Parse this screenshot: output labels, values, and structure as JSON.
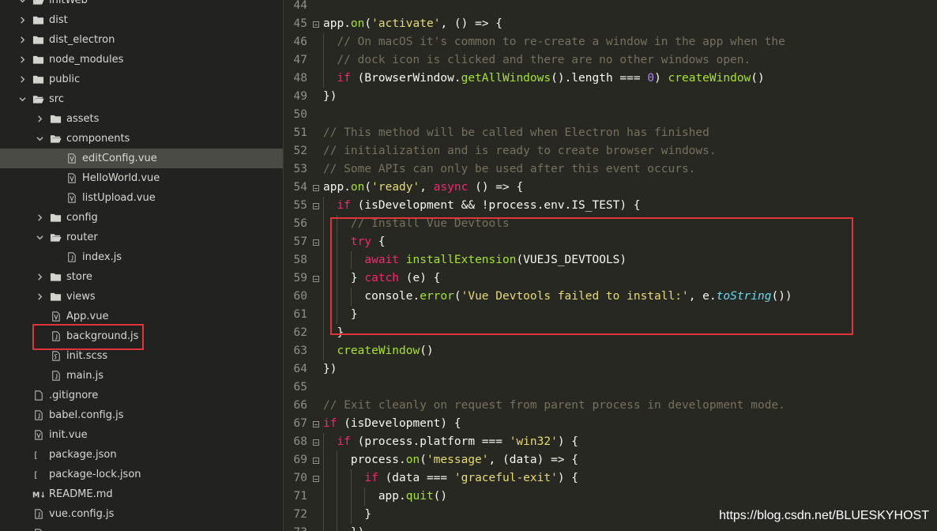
{
  "sidebar": {
    "items": [
      {
        "label": "initWeb",
        "type": "folder",
        "depth": 0,
        "open": true
      },
      {
        "label": "dist",
        "type": "folder",
        "depth": 1,
        "open": false
      },
      {
        "label": "dist_electron",
        "type": "folder",
        "depth": 1,
        "open": false
      },
      {
        "label": "node_modules",
        "type": "folder",
        "depth": 1,
        "open": false
      },
      {
        "label": "public",
        "type": "folder",
        "depth": 1,
        "open": false
      },
      {
        "label": "src",
        "type": "folder",
        "depth": 1,
        "open": true
      },
      {
        "label": "assets",
        "type": "folder",
        "depth": 2,
        "open": false
      },
      {
        "label": "components",
        "type": "folder",
        "depth": 2,
        "open": true
      },
      {
        "label": "editConfig.vue",
        "type": "vue",
        "depth": 3,
        "selected": true
      },
      {
        "label": "HelloWorld.vue",
        "type": "vue",
        "depth": 3
      },
      {
        "label": "listUpload.vue",
        "type": "vue",
        "depth": 3
      },
      {
        "label": "config",
        "type": "folder",
        "depth": 2,
        "open": false
      },
      {
        "label": "router",
        "type": "folder",
        "depth": 2,
        "open": true
      },
      {
        "label": "index.js",
        "type": "js",
        "depth": 3
      },
      {
        "label": "store",
        "type": "folder",
        "depth": 2,
        "open": false
      },
      {
        "label": "views",
        "type": "folder",
        "depth": 2,
        "open": false
      },
      {
        "label": "App.vue",
        "type": "vue",
        "depth": 2
      },
      {
        "label": "background.js",
        "type": "js",
        "depth": 2,
        "highlighted": true
      },
      {
        "label": "init.scss",
        "type": "scss",
        "depth": 2
      },
      {
        "label": "main.js",
        "type": "js",
        "depth": 2
      },
      {
        "label": ".gitignore",
        "type": "file",
        "depth": 1
      },
      {
        "label": "babel.config.js",
        "type": "js",
        "depth": 1
      },
      {
        "label": "init.vue",
        "type": "vue",
        "depth": 1
      },
      {
        "label": "package.json",
        "type": "json",
        "depth": 1
      },
      {
        "label": "package-lock.json",
        "type": "json",
        "depth": 1
      },
      {
        "label": "README.md",
        "type": "md",
        "depth": 1
      },
      {
        "label": "vue.config.js",
        "type": "js",
        "depth": 1
      },
      {
        "label": "",
        "type": "file",
        "depth": 1
      }
    ]
  },
  "editor": {
    "lines": [
      {
        "n": "44",
        "fold": false,
        "indent": 0,
        "tokens": []
      },
      {
        "n": "45",
        "fold": true,
        "indent": 0,
        "tokens": [
          [
            "p",
            "app."
          ],
          [
            "fn",
            "on"
          ],
          [
            "p",
            "("
          ],
          [
            "str",
            "'activate'"
          ],
          [
            "p",
            ", () => {"
          ]
        ]
      },
      {
        "n": "46",
        "fold": false,
        "indent": 1,
        "tokens": [
          [
            "cm",
            "// On macOS it's common to re-create a window in the app when the"
          ]
        ]
      },
      {
        "n": "47",
        "fold": false,
        "indent": 1,
        "tokens": [
          [
            "cm",
            "// dock icon is clicked and there are no other windows open."
          ]
        ]
      },
      {
        "n": "48",
        "fold": false,
        "indent": 1,
        "tokens": [
          [
            "kw",
            "if"
          ],
          [
            "p",
            " (BrowserWindow."
          ],
          [
            "fn",
            "getAllWindows"
          ],
          [
            "p",
            "().length === "
          ],
          [
            "num",
            "0"
          ],
          [
            "p",
            ") "
          ],
          [
            "fn",
            "createWindow"
          ],
          [
            "p",
            "()"
          ]
        ]
      },
      {
        "n": "49",
        "fold": false,
        "indent": 0,
        "tokens": [
          [
            "p",
            "})"
          ]
        ]
      },
      {
        "n": "50",
        "fold": false,
        "indent": 0,
        "tokens": []
      },
      {
        "n": "51",
        "fold": false,
        "indent": 0,
        "tokens": [
          [
            "cm",
            "// This method will be called when Electron has finished"
          ]
        ]
      },
      {
        "n": "52",
        "fold": false,
        "indent": 0,
        "tokens": [
          [
            "cm",
            "// initialization and is ready to create browser windows."
          ]
        ]
      },
      {
        "n": "53",
        "fold": false,
        "indent": 0,
        "tokens": [
          [
            "cm",
            "// Some APIs can only be used after this event occurs."
          ]
        ]
      },
      {
        "n": "54",
        "fold": true,
        "indent": 0,
        "tokens": [
          [
            "p",
            "app."
          ],
          [
            "fn",
            "on"
          ],
          [
            "p",
            "("
          ],
          [
            "str",
            "'ready'"
          ],
          [
            "p",
            ", "
          ],
          [
            "kw",
            "async"
          ],
          [
            "p",
            " () => {"
          ]
        ]
      },
      {
        "n": "55",
        "fold": true,
        "indent": 1,
        "tokens": [
          [
            "kw",
            "if"
          ],
          [
            "p",
            " (isDevelopment && !process.env.IS_TEST) {"
          ]
        ]
      },
      {
        "n": "56",
        "fold": false,
        "indent": 2,
        "tokens": [
          [
            "cm",
            "// Install Vue Devtools"
          ]
        ]
      },
      {
        "n": "57",
        "fold": true,
        "indent": 2,
        "tokens": [
          [
            "kw",
            "try"
          ],
          [
            "p",
            " {"
          ]
        ]
      },
      {
        "n": "58",
        "fold": false,
        "indent": 3,
        "tokens": [
          [
            "kw",
            "await"
          ],
          [
            "p",
            " "
          ],
          [
            "fn",
            "installExtension"
          ],
          [
            "p",
            "(VUEJS_DEVTOOLS)"
          ]
        ]
      },
      {
        "n": "59",
        "fold": true,
        "indent": 2,
        "tokens": [
          [
            "p",
            "} "
          ],
          [
            "kw",
            "catch"
          ],
          [
            "p",
            " (e) {"
          ]
        ]
      },
      {
        "n": "60",
        "fold": false,
        "indent": 3,
        "tokens": [
          [
            "p",
            "console."
          ],
          [
            "fn",
            "error"
          ],
          [
            "p",
            "("
          ],
          [
            "str",
            "'Vue Devtools failed to install:'"
          ],
          [
            "p",
            ", e."
          ],
          [
            "it",
            "toString"
          ],
          [
            "p",
            "())"
          ]
        ]
      },
      {
        "n": "61",
        "fold": false,
        "indent": 2,
        "tokens": [
          [
            "p",
            "}"
          ]
        ]
      },
      {
        "n": "62",
        "fold": false,
        "indent": 1,
        "tokens": [
          [
            "p",
            "}"
          ]
        ]
      },
      {
        "n": "63",
        "fold": false,
        "indent": 1,
        "tokens": [
          [
            "fn",
            "createWindow"
          ],
          [
            "p",
            "()"
          ]
        ]
      },
      {
        "n": "64",
        "fold": false,
        "indent": 0,
        "tokens": [
          [
            "p",
            "})"
          ]
        ]
      },
      {
        "n": "65",
        "fold": false,
        "indent": 0,
        "tokens": []
      },
      {
        "n": "66",
        "fold": false,
        "indent": 0,
        "tokens": [
          [
            "cm",
            "// Exit cleanly on request from parent process in development mode."
          ]
        ]
      },
      {
        "n": "67",
        "fold": true,
        "indent": 0,
        "tokens": [
          [
            "kw",
            "if"
          ],
          [
            "p",
            " (isDevelopment) {"
          ]
        ]
      },
      {
        "n": "68",
        "fold": true,
        "indent": 1,
        "tokens": [
          [
            "kw",
            "if"
          ],
          [
            "p",
            " (process.platform === "
          ],
          [
            "str",
            "'win32'"
          ],
          [
            "p",
            ") {"
          ]
        ]
      },
      {
        "n": "69",
        "fold": true,
        "indent": 2,
        "tokens": [
          [
            "p",
            "process."
          ],
          [
            "fn",
            "on"
          ],
          [
            "p",
            "("
          ],
          [
            "str",
            "'message'"
          ],
          [
            "p",
            ", (data) => {"
          ]
        ]
      },
      {
        "n": "70",
        "fold": true,
        "indent": 3,
        "tokens": [
          [
            "kw",
            "if"
          ],
          [
            "p",
            " (data === "
          ],
          [
            "str",
            "'graceful-exit'"
          ],
          [
            "p",
            ") {"
          ]
        ]
      },
      {
        "n": "71",
        "fold": false,
        "indent": 4,
        "tokens": [
          [
            "p",
            "app."
          ],
          [
            "fn",
            "quit"
          ],
          [
            "p",
            "()"
          ]
        ]
      },
      {
        "n": "72",
        "fold": false,
        "indent": 3,
        "tokens": [
          [
            "p",
            "}"
          ]
        ]
      },
      {
        "n": "73",
        "fold": false,
        "indent": 2,
        "tokens": [
          [
            "p",
            "})"
          ]
        ]
      }
    ]
  },
  "watermark": "https://blog.csdn.net/BLUESKYHOST",
  "colors": {
    "editor_bg": "#272822",
    "sidebar_bg": "#222320",
    "comment": "#75715e",
    "string": "#e6db74",
    "keyword": "#f92672",
    "function": "#a6e22e",
    "number": "#ae81ff",
    "italic": "#66d9ef",
    "highlight_box": "#e0353b"
  },
  "icons": {
    "folder": "folder-icon",
    "file": "file-icon",
    "chevron_right": "chevron-right-icon",
    "chevron_down": "chevron-down-icon",
    "fold": "fold-marker-icon"
  }
}
